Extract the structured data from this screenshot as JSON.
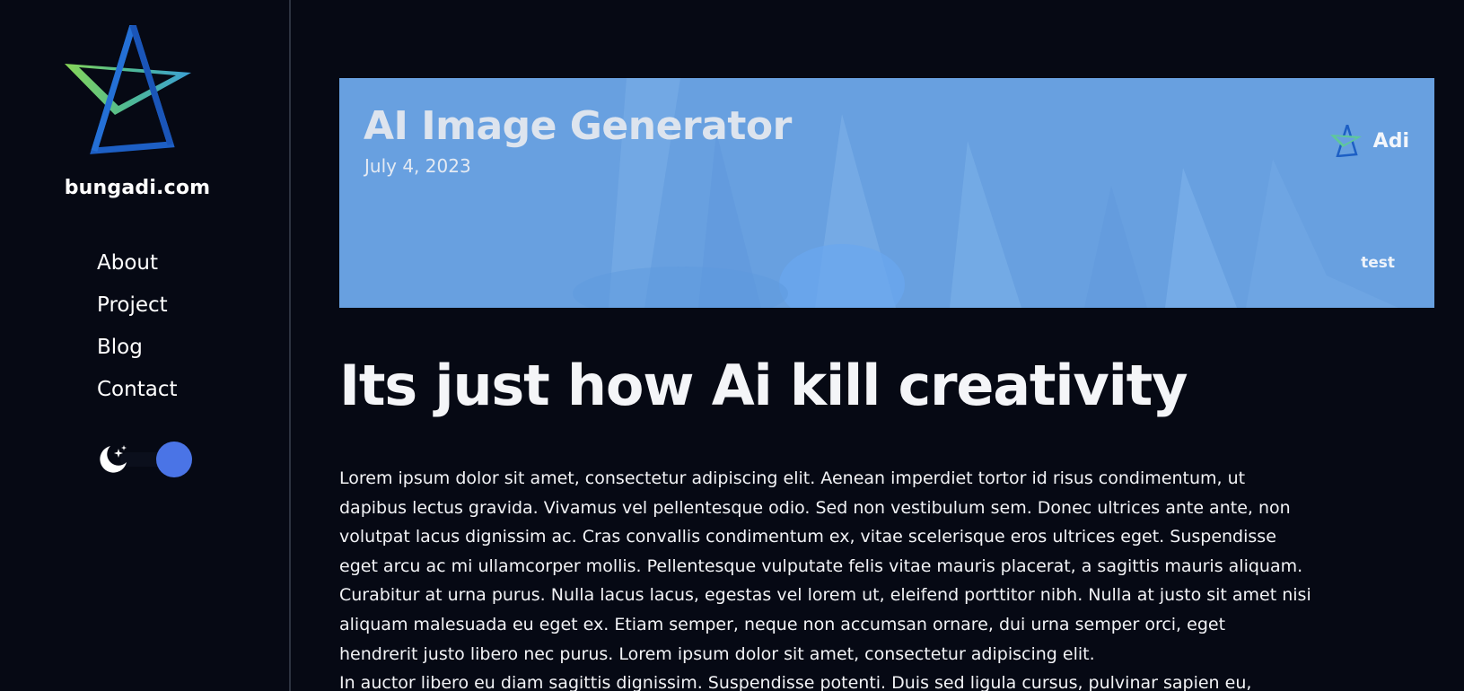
{
  "site": {
    "name": "bungadi.com",
    "logo_icon": "star-logo-icon"
  },
  "nav": {
    "items": [
      {
        "label": "About"
      },
      {
        "label": "Project"
      },
      {
        "label": "Blog"
      },
      {
        "label": "Contact"
      }
    ]
  },
  "theme_toggle": {
    "icon": "moon-stars-icon",
    "state": "dark"
  },
  "hero": {
    "title": "AI Image Generator",
    "date": "July 4, 2023",
    "author": "Adi",
    "tag": "test"
  },
  "post": {
    "title": "Its just how Ai kill creativity",
    "body_lines": [
      "Lorem ipsum dolor sit amet, consectetur adipiscing elit. Aenean imperdiet tortor id risus condimentum, ut",
      "dapibus lectus gravida. Vivamus vel pellentesque odio. Sed non vestibulum sem. Donec ultrices ante ante, non",
      "volutpat lacus dignissim ac. Cras convallis condimentum ex, vitae scelerisque eros ultrices eget. Suspendisse",
      "eget arcu ac mi ullamcorper mollis. Pellentesque vulputate felis vitae mauris placerat, a sagittis mauris aliquam.",
      "Curabitur at urna purus. Nulla lacus lacus, egestas vel lorem ut, eleifend porttitor nibh. Nulla at justo sit amet nisi",
      "aliquam malesuada eu eget ex. Etiam semper, neque non accumsan ornare, dui urna semper orci, eget",
      "hendrerit justo libero nec purus. Lorem ipsum dolor sit amet, consectetur adipiscing elit.",
      "In auctor libero eu diam sagittis dignissim. Suspendisse potenti. Duis sed ligula cursus, pulvinar sapien eu,"
    ]
  },
  "colors": {
    "background": "#060914",
    "hero_bg": "#6aa3e2",
    "toggle_knob": "#4a74e6",
    "logo_blue": "#1f5fc8",
    "logo_green": "#7ed957",
    "logo_cyan": "#4fb7e0"
  }
}
